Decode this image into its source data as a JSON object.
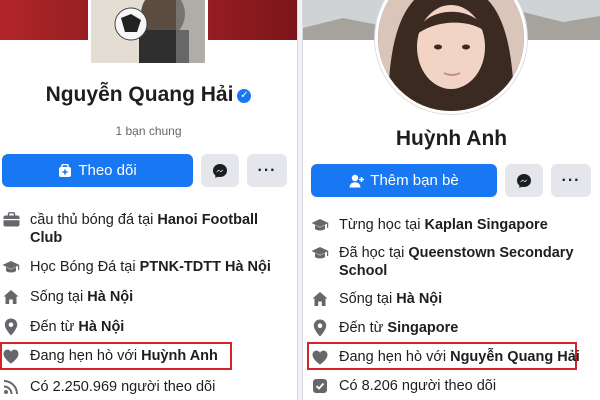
{
  "left": {
    "name": "Nguyễn Quang Hải",
    "mutual_friends": "1 bạn chung",
    "primary_button": "Theo dõi",
    "more_label": "···",
    "rows": [
      {
        "icon": "briefcase-icon",
        "text": "cầu thủ bóng đá tại ",
        "bold": "Hanoi Football Club"
      },
      {
        "icon": "graduation-cap-icon",
        "text": "Học Bóng Đá tại ",
        "bold": "PTNK-TDTT Hà Nội"
      },
      {
        "icon": "home-icon",
        "text": "Sống tại ",
        "bold": "Hà Nội"
      },
      {
        "icon": "location-pin-icon",
        "text": "Đến từ ",
        "bold": "Hà Nội"
      },
      {
        "icon": "heart-icon",
        "text": "Đang hẹn hò với ",
        "bold": "Huỳnh Anh"
      },
      {
        "icon": "rss-icon",
        "text": "Có 2.250.969 người theo dõi",
        "bold": ""
      }
    ]
  },
  "right": {
    "name": "Huỳnh Anh",
    "primary_button": "Thêm bạn bè",
    "more_label": "···",
    "rows": [
      {
        "icon": "graduation-cap-icon",
        "text": "Từng học tại ",
        "bold": "Kaplan Singapore"
      },
      {
        "icon": "graduation-cap-icon",
        "text": "Đã học tại ",
        "bold": "Queenstown Secondary School"
      },
      {
        "icon": "home-icon",
        "text": "Sống tại ",
        "bold": "Hà Nội"
      },
      {
        "icon": "location-pin-icon",
        "text": "Đến từ ",
        "bold": "Singapore"
      },
      {
        "icon": "heart-icon",
        "text": "Đang hẹn hò với ",
        "bold": "Nguyễn Quang Hải"
      },
      {
        "icon": "check-box-icon",
        "text": "Có 8.206 người theo dõi",
        "bold": ""
      }
    ]
  },
  "colors": {
    "accent": "#1877f2",
    "highlight": "#d4242b",
    "secondary_button": "#e4e6eb",
    "muted_text": "#65676b"
  }
}
